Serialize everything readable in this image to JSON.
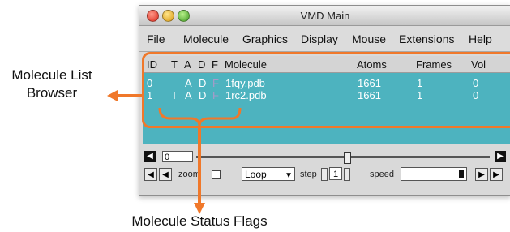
{
  "window": {
    "title": "VMD Main",
    "menu": [
      "File",
      "Molecule",
      "Graphics",
      "Display",
      "Mouse",
      "Extensions",
      "Help"
    ]
  },
  "molecule_list": {
    "columns": [
      "ID",
      "T",
      "A",
      "D",
      "F",
      "Molecule",
      "Atoms",
      "Frames",
      "Vol"
    ],
    "rows": [
      {
        "id": "0",
        "t": "",
        "a": "A",
        "d": "D",
        "f": "F",
        "molecule": "1fqy.pdb",
        "atoms": "1661",
        "frames": "1",
        "vol": "0"
      },
      {
        "id": "1",
        "t": "T",
        "a": "A",
        "d": "D",
        "f": "F",
        "molecule": "1rc2.pdb",
        "atoms": "1661",
        "frames": "1",
        "vol": "0"
      }
    ]
  },
  "timeline": {
    "frame": "0"
  },
  "controls": {
    "zoom_label": "zoom",
    "loop_value": "Loop",
    "step_label": "step",
    "step_value": "1",
    "speed_label": "speed"
  },
  "annotations": {
    "list_browser_line1": "Molecule List",
    "list_browser_line2": "Browser",
    "status_flags": "Molecule Status Flags"
  },
  "colors": {
    "accent": "#f0782a",
    "list_bg": "#4db3bf",
    "f_flag": "#a79ac9"
  }
}
